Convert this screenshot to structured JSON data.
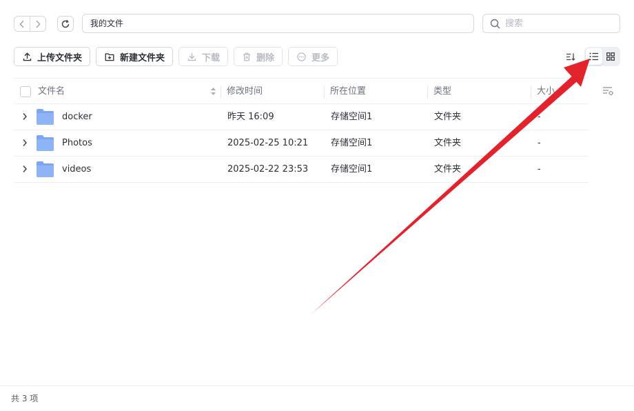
{
  "path": {
    "current": "我的文件"
  },
  "search": {
    "placeholder": "搜索"
  },
  "toolbar": {
    "upload_label": "上传文件夹",
    "new_folder_label": "新建文件夹",
    "download_label": "下载",
    "delete_label": "删除",
    "more_label": "更多"
  },
  "view": {
    "active": "list"
  },
  "table": {
    "headers": {
      "name": "文件名",
      "modified": "修改时间",
      "location": "所在位置",
      "type": "类型",
      "size": "大小"
    },
    "rows": [
      {
        "name": "docker",
        "modified": "昨天 16:09",
        "location": "存储空间1",
        "type": "文件夹",
        "size": "-"
      },
      {
        "name": "Photos",
        "modified": "2025-02-25 10:21",
        "location": "存储空间1",
        "type": "文件夹",
        "size": "-"
      },
      {
        "name": "videos",
        "modified": "2025-02-22 23:53",
        "location": "存储空间1",
        "type": "文件夹",
        "size": "-"
      }
    ]
  },
  "footer": {
    "count_text": "共 3 项"
  },
  "colors": {
    "folder": "#7da5f5",
    "annotation_arrow": "#e3232c",
    "accent": "#2b2f36"
  },
  "icons": [
    "chevron-left-icon",
    "chevron-right-icon",
    "refresh-icon",
    "search-icon",
    "upload-icon",
    "new-folder-icon",
    "download-icon",
    "trash-icon",
    "more-icon",
    "sort-icon",
    "list-view-icon",
    "grid-view-icon",
    "column-settings-icon",
    "folder-icon",
    "expand-icon"
  ]
}
